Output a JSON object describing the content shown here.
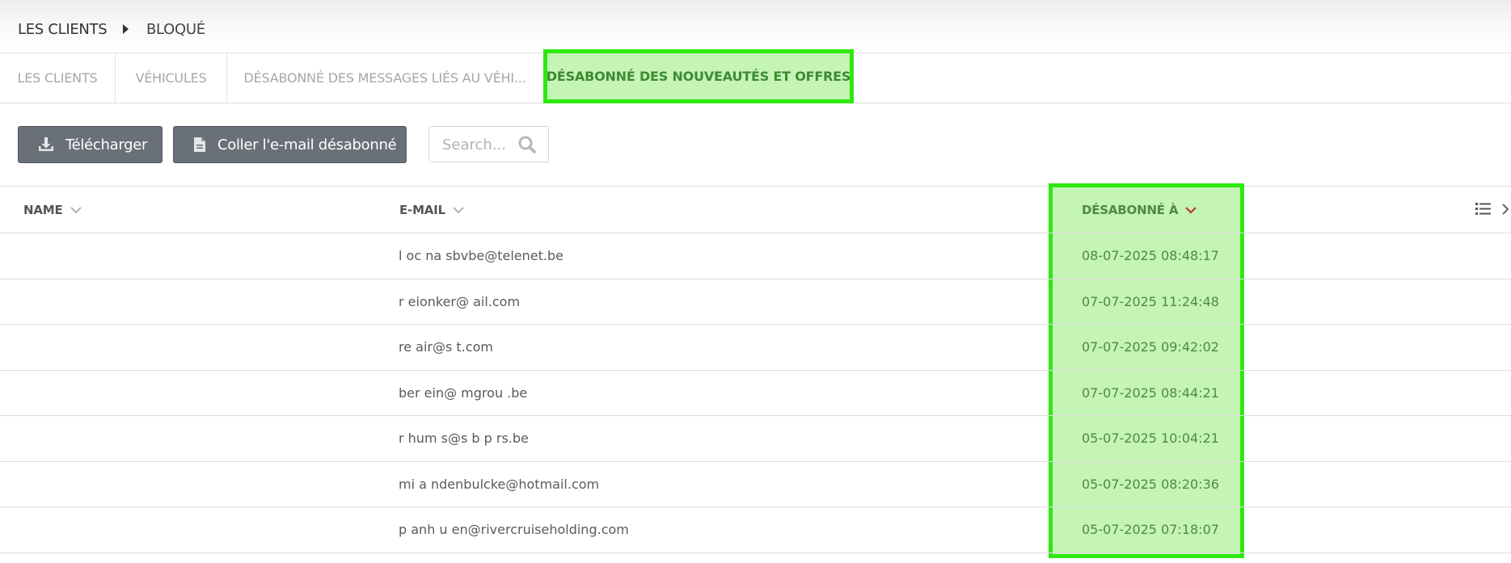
{
  "breadcrumb": {
    "root": "LES CLIENTS",
    "current": "BLOQUÉ"
  },
  "tabs": [
    {
      "label": "LES CLIENTS"
    },
    {
      "label": "VÉHICULES"
    },
    {
      "label": "DÉSABONNÉ DES MESSAGES LIÉS AU VÉHI..."
    },
    {
      "label": "DÉSABONNÉ DES NOUVEAUTÉS ET OFFRES",
      "active": true
    }
  ],
  "toolbar": {
    "download_label": "Télécharger",
    "paste_label": "Coller l'e-mail désabonné",
    "search_placeholder": "Search...",
    "download_icon": "download-icon",
    "paste_icon": "document-icon",
    "search_icon": "search-icon"
  },
  "table": {
    "columns": {
      "name": "NAME",
      "email": "E-MAIL",
      "unsubscribed_at": "DÉSABONNÉ À"
    },
    "sorted_column": "unsubscribed_at",
    "sort_direction": "desc",
    "rows": [
      {
        "name": "",
        "email": "l oc  na  sbvbe@telenet.be",
        "unsubscribed_at": "08-07-2025 08:48:17"
      },
      {
        "name": "",
        "email": "r  eionker@  ail.com",
        "unsubscribed_at": "07-07-2025 11:24:48"
      },
      {
        "name": "",
        "email": "re air@s  t.com",
        "unsubscribed_at": "07-07-2025 09:42:02"
      },
      {
        "name": "",
        "email": "ber  ein@  mgrou .be",
        "unsubscribed_at": "07-07-2025 08:44:21"
      },
      {
        "name": "",
        "email": "r  hum    s@s  b  p  rs.be",
        "unsubscribed_at": "05-07-2025 10:04:21"
      },
      {
        "name": "",
        "email": "mi  a   ndenbulcke@hotmail.com",
        "unsubscribed_at": "05-07-2025 08:20:36"
      },
      {
        "name": "",
        "email": "p  anh  u  en@rivercruiseholding.com",
        "unsubscribed_at": "05-07-2025 07:18:07"
      }
    ]
  },
  "colors": {
    "highlight_fill": "#c4f4b6",
    "highlight_border": "#2ee80e",
    "accent_text": "#4e8a45",
    "sort_arrow": "#c0392b",
    "button": "#6a7078"
  }
}
